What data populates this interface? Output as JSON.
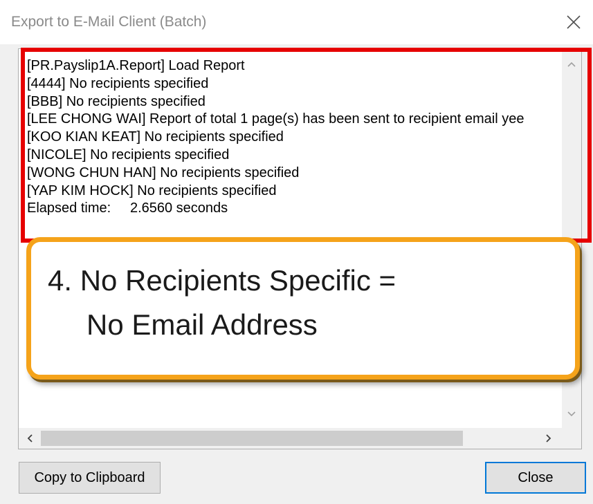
{
  "window": {
    "title": "Export to E-Mail Client (Batch)"
  },
  "log": {
    "lines": [
      "[PR.Payslip1A.Report] Load Report",
      "[4444] No recipients specified",
      "[BBB] No recipients specified",
      "[LEE CHONG WAI] Report of total 1 page(s) has been sent to recipient email yee",
      "[KOO KIAN KEAT] No recipients specified",
      "[NICOLE] No recipients specified",
      "[WONG CHUN HAN] No recipients specified",
      "[YAP KIM HOCK] No recipients specified",
      "Elapsed time:     2.6560 seconds"
    ]
  },
  "annotation": {
    "line1": "4. No Recipients Specific =",
    "line2": "No Email Address",
    "highlight_color": "#e60000",
    "callout_border_color": "#f5a31a"
  },
  "buttons": {
    "copy_label": "Copy to Clipboard",
    "close_label": "Close"
  },
  "icons": {
    "close": "close-icon",
    "scroll_up": "chevron-up-icon",
    "scroll_down": "chevron-down-icon",
    "scroll_left": "chevron-left-icon",
    "scroll_right": "chevron-right-icon"
  }
}
